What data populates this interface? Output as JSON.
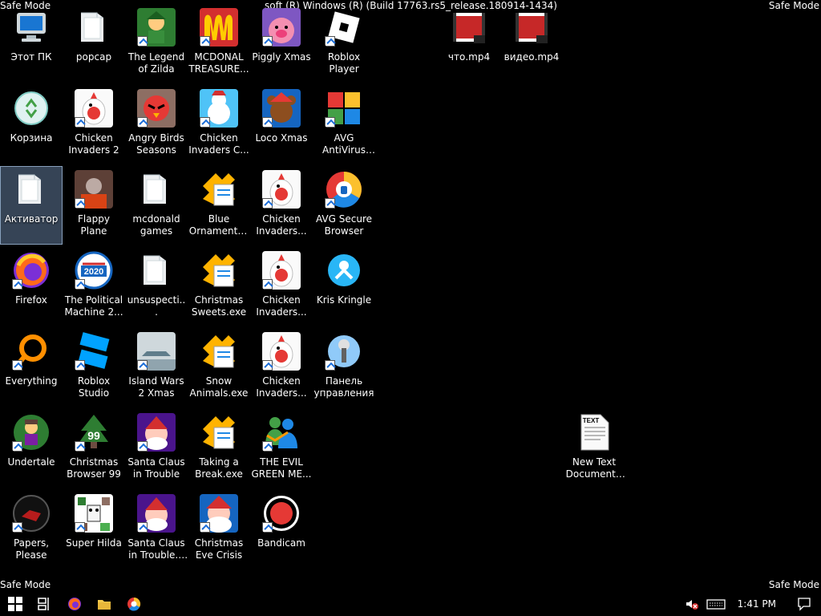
{
  "overlays": {
    "safe_mode": "Safe Mode",
    "build_text": "soft (R) Windows (R) (Build 17763.rs5_release.180914-1434)"
  },
  "desktop": {
    "icons": [
      {
        "label": "Этот ПК",
        "icon": "computer-icon",
        "shortcut": false
      },
      {
        "label": "popcap",
        "icon": "folder-icon",
        "shortcut": false
      },
      {
        "label": "The Legend of Zilda",
        "icon": "game-icon",
        "shortcut": true
      },
      {
        "label": "MCDONAL TREASURE...",
        "icon": "mcdonalds-icon",
        "shortcut": true
      },
      {
        "label": "Piggly Xmas",
        "icon": "pig-icon",
        "shortcut": true
      },
      {
        "label": "Roblox Player",
        "icon": "roblox-icon",
        "shortcut": true
      },
      {
        "label": "что.mp4",
        "icon": "video-file-icon",
        "shortcut": false
      },
      {
        "label": "видео.mp4",
        "icon": "video-file-icon",
        "shortcut": false
      },
      {
        "label": "Корзина",
        "icon": "recycle-bin-icon",
        "shortcut": false
      },
      {
        "label": "Chicken Invaders 2",
        "icon": "chicken-icon",
        "shortcut": true
      },
      {
        "label": "Angry Birds Seasons",
        "icon": "angry-birds-icon",
        "shortcut": true
      },
      {
        "label": "Chicken Invaders C...",
        "icon": "snowman-chicken-icon",
        "shortcut": true
      },
      {
        "label": "Loco Xmas",
        "icon": "bear-icon",
        "shortcut": true
      },
      {
        "label": "AVG AntiVirus Free",
        "icon": "avg-icon",
        "shortcut": true
      },
      {
        "label": "Активатор",
        "icon": "folder-icon",
        "shortcut": false,
        "selected": true
      },
      {
        "label": "Flappy Plane",
        "icon": "photo-icon",
        "shortcut": true
      },
      {
        "label": "mcdonald games",
        "icon": "folder-icon",
        "shortcut": false
      },
      {
        "label": "Blue Ornaments....",
        "icon": "exe-icon",
        "shortcut": false
      },
      {
        "label": "Chicken Invaders...",
        "icon": "chicken-icon",
        "shortcut": true
      },
      {
        "label": "AVG Secure Browser",
        "icon": "avg-browser-icon",
        "shortcut": true
      },
      {
        "label": "Firefox",
        "icon": "firefox-icon",
        "shortcut": true
      },
      {
        "label": "The Political Machine 2...",
        "icon": "political-icon",
        "shortcut": true
      },
      {
        "label": "unsuspecti...",
        "icon": "folder-icon",
        "shortcut": false
      },
      {
        "label": "Christmas Sweets.exe",
        "icon": "exe-icon",
        "shortcut": false
      },
      {
        "label": "Chicken Invaders...",
        "icon": "chicken-icon",
        "shortcut": true
      },
      {
        "label": "Kris Kringle",
        "icon": "kris-icon",
        "shortcut": false
      },
      {
        "label": "Everything",
        "icon": "search-icon",
        "shortcut": true
      },
      {
        "label": "Roblox Studio",
        "icon": "roblox-studio-icon",
        "shortcut": true
      },
      {
        "label": "Island Wars 2 Xmas",
        "icon": "island-icon",
        "shortcut": true
      },
      {
        "label": "Snow Animals.exe",
        "icon": "exe-icon",
        "shortcut": false
      },
      {
        "label": "Chicken Invaders...",
        "icon": "chicken-icon",
        "shortcut": true
      },
      {
        "label": "Панель управления",
        "icon": "control-panel-icon",
        "shortcut": true
      },
      {
        "label": "Undertale",
        "icon": "undertale-icon",
        "shortcut": true
      },
      {
        "label": "Christmas Browser 99",
        "icon": "tree-icon",
        "shortcut": true
      },
      {
        "label": "Santa Claus in Trouble",
        "icon": "santa-icon",
        "shortcut": true
      },
      {
        "label": "Taking a Break.exe",
        "icon": "exe-icon",
        "shortcut": false
      },
      {
        "label": "THE EVIL GREEN ME...",
        "icon": "messenger-icon",
        "shortcut": true
      },
      {
        "label": "New Text Document.txt",
        "icon": "text-file-icon",
        "shortcut": false
      },
      {
        "label": "Papers, Please",
        "icon": "papers-icon",
        "shortcut": true
      },
      {
        "label": "Super Hilda",
        "icon": "hilda-icon",
        "shortcut": true
      },
      {
        "label": "Santa Claus in Trouble... A...",
        "icon": "santa-icon",
        "shortcut": true
      },
      {
        "label": "Christmas Eve Crisis",
        "icon": "santa-face-icon",
        "shortcut": true
      },
      {
        "label": "Bandicam",
        "icon": "bandicam-icon",
        "shortcut": true
      }
    ]
  },
  "taskbar": {
    "buttons": [
      {
        "name": "start-button",
        "icon": "windows-icon"
      },
      {
        "name": "task-view-button",
        "icon": "task-view-icon"
      },
      {
        "name": "firefox-taskbar-button",
        "icon": "firefox-icon"
      },
      {
        "name": "file-explorer-button",
        "icon": "folder-icon"
      },
      {
        "name": "avg-browser-taskbar-button",
        "icon": "avg-browser-icon"
      }
    ],
    "clock": "1:41 PM"
  },
  "colors": {
    "background": "#000000",
    "selection": "#6f8fb6"
  }
}
